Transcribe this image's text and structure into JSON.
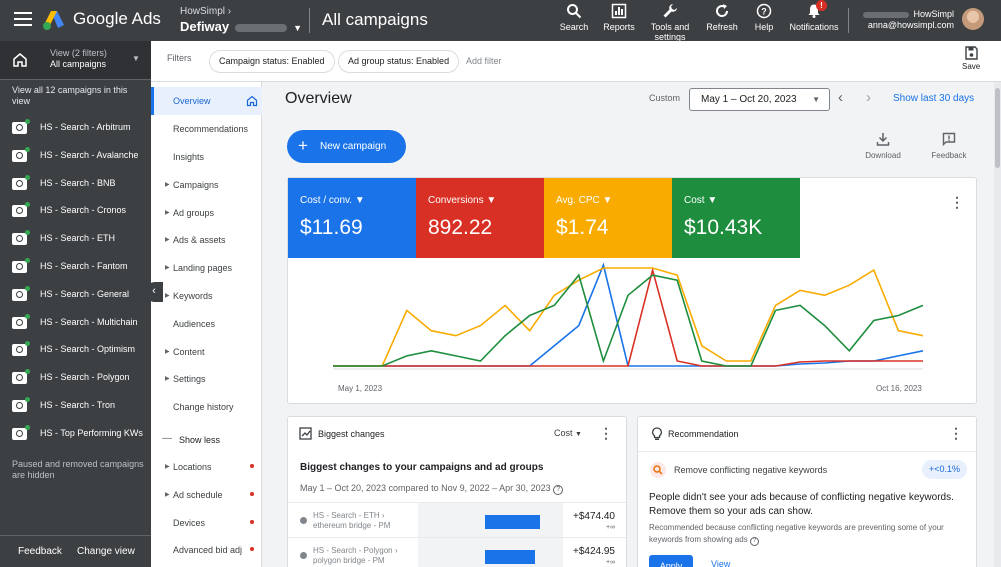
{
  "topbar": {
    "brand": "Google Ads",
    "account_parent": "HowSimpl",
    "account_name": "Defiway",
    "page_title": "All campaigns",
    "tools": [
      {
        "label": "Search",
        "icon": "search-icon"
      },
      {
        "label": "Reports",
        "icon": "reports-icon"
      },
      {
        "label": "Tools and settings",
        "icon": "wrench-icon"
      },
      {
        "label": "Refresh",
        "icon": "refresh-icon"
      },
      {
        "label": "Help",
        "icon": "help-icon"
      },
      {
        "label": "Notifications",
        "icon": "bell-icon"
      }
    ],
    "notification_badge": "!",
    "user_org": "HowSimpl",
    "user_email": "anna@howsimpl.com"
  },
  "campaign_panel": {
    "view_line1": "View (2 filters)",
    "view_line2": "All campaigns",
    "view_all": "View all 12 campaigns in this view",
    "campaigns": [
      "HS - Search - Arbitrum",
      "HS - Search - Avalanche",
      "HS - Search - BNB",
      "HS - Search - Cronos",
      "HS - Search - ETH",
      "HS - Search - Fantom",
      "HS - Search - General",
      "HS - Search - Multichain",
      "HS - Search - Optimism",
      "HS - Search - Polygon",
      "HS - Search - Tron",
      "HS - Top Performing KWs"
    ],
    "paused_note": "Paused and removed campaigns are hidden",
    "feedback": "Feedback",
    "change_view": "Change view"
  },
  "filters": {
    "label": "Filters",
    "chips": [
      "Campaign status: Enabled",
      "Ad group status: Enabled"
    ],
    "add_filter": "Add filter",
    "save": "Save"
  },
  "nav": {
    "items": [
      {
        "label": "Overview",
        "expandable": false,
        "dot": false,
        "active": true
      },
      {
        "label": "Recommendations",
        "expandable": false,
        "dot": false
      },
      {
        "label": "Insights",
        "expandable": false,
        "dot": false
      },
      {
        "label": "Campaigns",
        "expandable": true,
        "dot": false
      },
      {
        "label": "Ad groups",
        "expandable": true,
        "dot": false
      },
      {
        "label": "Ads & assets",
        "expandable": true,
        "dot": false
      },
      {
        "label": "Landing pages",
        "expandable": true,
        "dot": false
      },
      {
        "label": "Keywords",
        "expandable": true,
        "dot": false
      },
      {
        "label": "Audiences",
        "expandable": false,
        "dot": false
      },
      {
        "label": "Content",
        "expandable": true,
        "dot": false
      },
      {
        "label": "Settings",
        "expandable": true,
        "dot": false
      },
      {
        "label": "Change history",
        "expandable": false,
        "dot": false
      },
      {
        "label": "Show less",
        "expandable": false,
        "dot": false
      },
      {
        "label": "Locations",
        "expandable": true,
        "dot": true
      },
      {
        "label": "Ad schedule",
        "expandable": true,
        "dot": true
      },
      {
        "label": "Devices",
        "expandable": false,
        "dot": true
      },
      {
        "label": "Advanced bid adj",
        "expandable": false,
        "dot": true
      }
    ]
  },
  "overview": {
    "title": "Overview",
    "custom_label": "Custom",
    "date_range": "May 1 – Oct 20, 2023",
    "show_last": "Show last 30 days",
    "new_campaign": "New campaign",
    "download": "Download",
    "feedback": "Feedback",
    "metrics": [
      {
        "name": "Cost / conv.",
        "value": "$11.69",
        "color": "#1a73e8"
      },
      {
        "name": "Conversions",
        "value": "892.22",
        "color": "#d93025"
      },
      {
        "name": "Avg. CPC",
        "value": "$1.74",
        "color": "#f9ab00"
      },
      {
        "name": "Cost",
        "value": "$10.43K",
        "color": "#1e8e3e"
      }
    ],
    "x_start": "May 1, 2023",
    "x_end": "Oct 16, 2023"
  },
  "chart_data": {
    "type": "line",
    "x": [
      "May 1, 2023",
      "",
      "",
      "",
      "",
      "",
      "",
      "",
      "",
      "",
      "",
      "",
      "",
      "",
      "",
      "",
      "",
      "",
      "",
      "",
      "",
      "",
      "",
      "",
      "Oct 16, 2023"
    ],
    "series": [
      {
        "color": "#1a73e8",
        "values": [
          0,
          0,
          0,
          0,
          0,
          0,
          0,
          0,
          0,
          0.2,
          0.4,
          1.0,
          0,
          0,
          0,
          0,
          0,
          0,
          0,
          0.02,
          0.03,
          0.05,
          0.05,
          0.1,
          0.15
        ]
      },
      {
        "color": "#d93025",
        "values": [
          0,
          0,
          0,
          0,
          0,
          0,
          0,
          0,
          0,
          0,
          0,
          0,
          0,
          0.95,
          0.05,
          0,
          0,
          0,
          0,
          0.04,
          0.05,
          0.05,
          0.05,
          0.05,
          0.05
        ]
      },
      {
        "color": "#f9ab00",
        "values": [
          0,
          0,
          0,
          0.55,
          0.35,
          0.3,
          0.4,
          0.6,
          0.35,
          0.7,
          0.85,
          0.97,
          0.97,
          0.97,
          0.9,
          0.2,
          0.05,
          0.05,
          0.6,
          0.75,
          0.7,
          0.8,
          0.95,
          0.35,
          0.3
        ]
      },
      {
        "color": "#1e8e3e",
        "values": [
          0,
          0,
          0,
          0.1,
          0.15,
          0.1,
          0.05,
          0.3,
          0.5,
          0.6,
          0.9,
          0.05,
          0.7,
          0.9,
          0.85,
          0.05,
          0,
          0,
          0.55,
          0.6,
          0.4,
          0.15,
          0.45,
          0.5,
          0.6
        ]
      }
    ]
  },
  "biggest_changes": {
    "title": "Biggest changes",
    "metric": "Cost",
    "heading": "Biggest changes to your campaigns and ad groups",
    "comparison": "May 1 – Oct 20, 2023 compared to Nov 9, 2022 – Apr 30, 2023",
    "rows": [
      {
        "campaign": "HS - Search - ETH ›",
        "ad_group": "ethereum bridge - PM",
        "amount": "+$474.40",
        "inf": "+∞",
        "share": 1.0
      },
      {
        "campaign": "HS - Search - Polygon ›",
        "ad_group": "polygon bridge - PM",
        "amount": "+$424.95",
        "inf": "+∞",
        "share": 0.9
      }
    ]
  },
  "recommendation": {
    "title": "Recommendation",
    "item": "Remove conflicting negative keywords",
    "badge": "+<0.1%",
    "headline": "People didn't see your ads because of conflicting negative keywords. Remove them so your ads can show.",
    "body": "Recommended because conflicting negative keywords are preventing some of your keywords from showing ads",
    "apply": "Apply",
    "view": "View"
  }
}
